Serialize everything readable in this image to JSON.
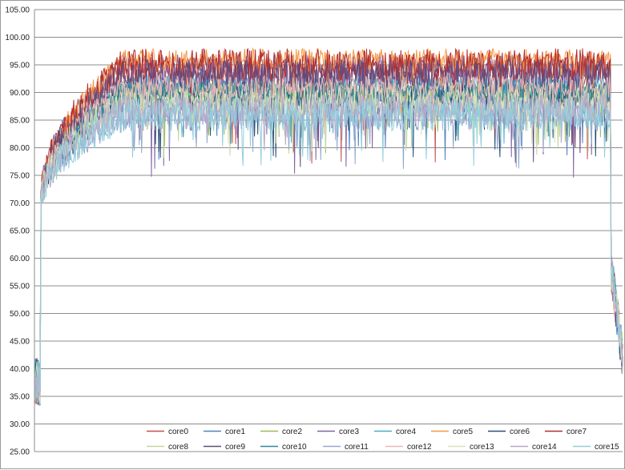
{
  "chart_data": {
    "type": "line",
    "title": "",
    "xlabel": "",
    "ylabel": "",
    "ylim": [
      25,
      105
    ],
    "y_ticks": [
      "25.00",
      "30.00",
      "35.00",
      "40.00",
      "45.00",
      "50.00",
      "55.00",
      "60.00",
      "65.00",
      "70.00",
      "75.00",
      "80.00",
      "85.00",
      "90.00",
      "95.00",
      "100.00",
      "105.00"
    ],
    "x_tick_labels": "none",
    "grid": "horizontal major gridlines",
    "legend_position": "bottom",
    "num_samples": 720,
    "phases": {
      "idle_start_end_index": 8,
      "ramp_end_index": 120,
      "load_end_index": 705,
      "idle_start_range": [
        33,
        48
      ],
      "idle_end_range": [
        39,
        64
      ]
    },
    "series": [
      {
        "name": "core0",
        "color": "#c0504d",
        "load_level": 94,
        "load_spread": 3,
        "dip_min": 77
      },
      {
        "name": "core1",
        "color": "#4f81bd",
        "load_level": 90,
        "load_spread": 3,
        "dip_min": 76
      },
      {
        "name": "core2",
        "color": "#9bbb59",
        "load_level": 90,
        "load_spread": 2,
        "dip_min": 79
      },
      {
        "name": "core3",
        "color": "#8064a2",
        "load_level": 94,
        "load_spread": 3,
        "dip_min": 74
      },
      {
        "name": "core4",
        "color": "#4bacc6",
        "load_level": 91,
        "load_spread": 2,
        "dip_min": 80
      },
      {
        "name": "core5",
        "color": "#f79646",
        "load_level": 96,
        "load_spread": 2,
        "dip_min": 83
      },
      {
        "name": "core6",
        "color": "#2c4d75",
        "load_level": 89,
        "load_spread": 3,
        "dip_min": 78
      },
      {
        "name": "core7",
        "color": "#b22d2d",
        "load_level": 95,
        "load_spread": 3,
        "dip_min": 81
      },
      {
        "name": "core8",
        "color": "#c3d69b",
        "load_level": 89,
        "load_spread": 3,
        "dip_min": 78
      },
      {
        "name": "core9",
        "color": "#604a7b",
        "load_level": 93,
        "load_spread": 3,
        "dip_min": 76
      },
      {
        "name": "core10",
        "color": "#31859c",
        "load_level": 90,
        "load_spread": 2,
        "dip_min": 80
      },
      {
        "name": "core11",
        "color": "#93a9cf",
        "load_level": 86,
        "load_spread": 3,
        "dip_min": 76
      },
      {
        "name": "core12",
        "color": "#e6b9b8",
        "load_level": 91,
        "load_spread": 2,
        "dip_min": 82
      },
      {
        "name": "core13",
        "color": "#d7e4bd",
        "load_level": 88,
        "load_spread": 3,
        "dip_min": 80
      },
      {
        "name": "core14",
        "color": "#b7a8cc",
        "load_level": 87,
        "load_spread": 3,
        "dip_min": 79
      },
      {
        "name": "core15",
        "color": "#92cddc",
        "load_level": 86,
        "load_spread": 3,
        "dip_min": 76
      }
    ]
  }
}
